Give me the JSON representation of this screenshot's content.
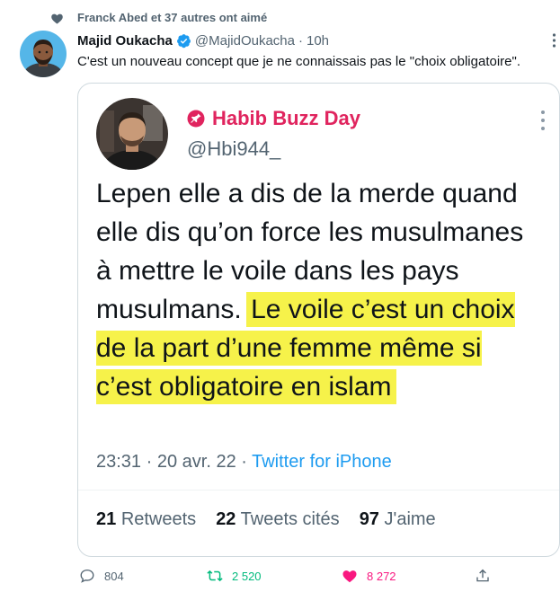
{
  "social_context": {
    "text": "Franck Abed et 37 autres ont aimé"
  },
  "tweet": {
    "author_name": "Majid Oukacha",
    "author_handle": "@MajidOukacha",
    "separator": "·",
    "time": "10h",
    "text": "C'est un nouveau concept que je ne connaissais pas le \"choix obligatoire\"."
  },
  "quoted": {
    "name": "Habib Buzz Day",
    "handle": "@Hbi944_",
    "text_plain": "Lepen elle a dis de la merde quand elle dis qu’on force les musulmanes à mettre le voile dans les pays musulmans.",
    "text_highlight": "Le voile c’est un choix de la part d’une femme même si c’est obligatoire en islam",
    "time": "23:31",
    "date": "20 avr. 22",
    "source": "Twitter for iPhone",
    "stats": {
      "retweets_count": "21",
      "retweets_label": "Retweets",
      "quotes_count": "22",
      "quotes_label": "Tweets cités",
      "likes_count": "97",
      "likes_label": "J'aime"
    }
  },
  "actions": {
    "replies": "804",
    "retweets": "2 520",
    "likes": "8 272"
  },
  "colors": {
    "accent_blue": "#1d9bf0",
    "retweet_green": "#00ba7c",
    "like_pink": "#f91880",
    "quoted_name": "#e0245e",
    "highlight": "#f6f24a"
  },
  "icons": [
    "heart-icon",
    "verified-badge-icon",
    "more-icon",
    "pin-icon",
    "reply-icon",
    "retweet-icon",
    "like-icon",
    "share-icon"
  ]
}
